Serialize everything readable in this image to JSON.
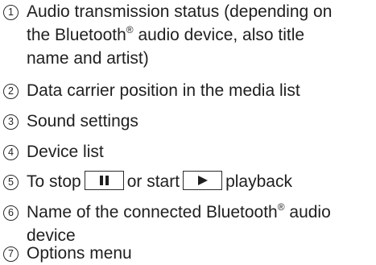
{
  "items": [
    {
      "num": "1",
      "lines": [
        "Audio transmission status (depending on",
        "the Bluetooth",
        "audio device, also title",
        "name and artist)"
      ],
      "reg": "®"
    },
    {
      "num": "2",
      "text": "Data carrier position in the media list"
    },
    {
      "num": "3",
      "text": "Sound settings"
    },
    {
      "num": "4",
      "text": "Device list"
    },
    {
      "num": "5",
      "parts": {
        "a": "To stop",
        "b": "or start",
        "c": "playback"
      },
      "icons": [
        "pause-icon",
        "play-icon"
      ]
    },
    {
      "num": "6",
      "line1a": "Name of the connected Bluetooth",
      "reg": "®",
      "line1b": " audio",
      "line2": "device"
    },
    {
      "num": "7",
      "text": "Options menu"
    }
  ]
}
